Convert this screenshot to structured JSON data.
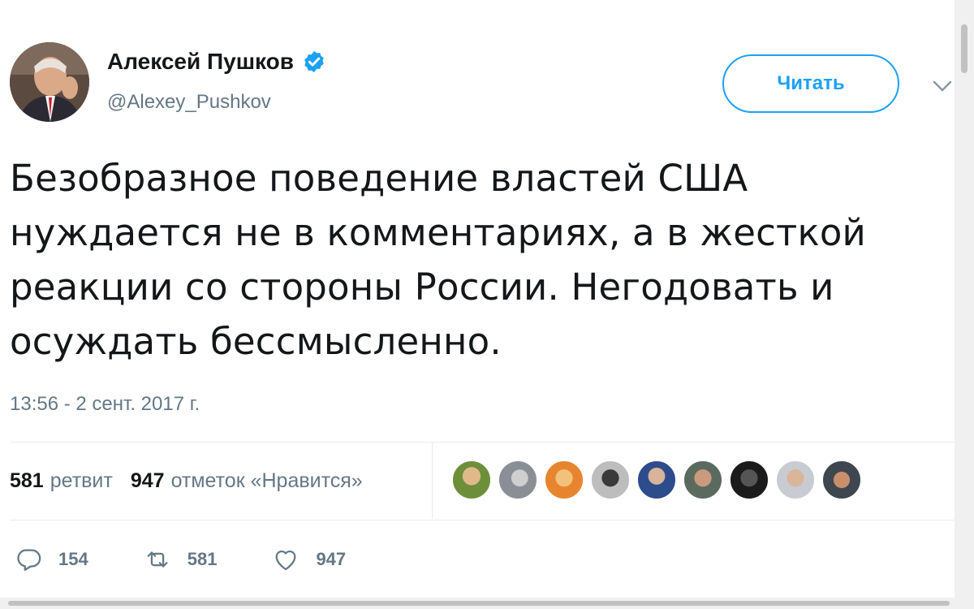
{
  "author": {
    "name": "Алексей Пушков",
    "handle": "@Alexey_Pushkov",
    "verified": true
  },
  "follow_button": {
    "label": "Читать"
  },
  "tweet": {
    "text_lines": [
      "Безобразное поведение властей США",
      "нуждается не в комментариях, а в жесткой",
      "реакции со стороны России. Негодовать и",
      "осуждать бессмысленно."
    ],
    "timestamp": "13:56 - 2 сент. 2017 г."
  },
  "stats": {
    "retweets_count": "581",
    "retweets_label": "ретвит",
    "likes_count": "947",
    "likes_label": "отметок «Нравится»"
  },
  "actions": {
    "reply_count": "154",
    "retweet_count": "581",
    "like_count": "947"
  },
  "icons": {
    "verified": "verified-badge-icon",
    "caret": "chevron-down-icon",
    "reply": "reply-icon",
    "retweet": "retweet-icon",
    "like": "heart-icon"
  },
  "colors": {
    "accent": "#1da1f2",
    "text": "#14171a",
    "muted": "#657786",
    "divider": "#e6ecf0"
  }
}
